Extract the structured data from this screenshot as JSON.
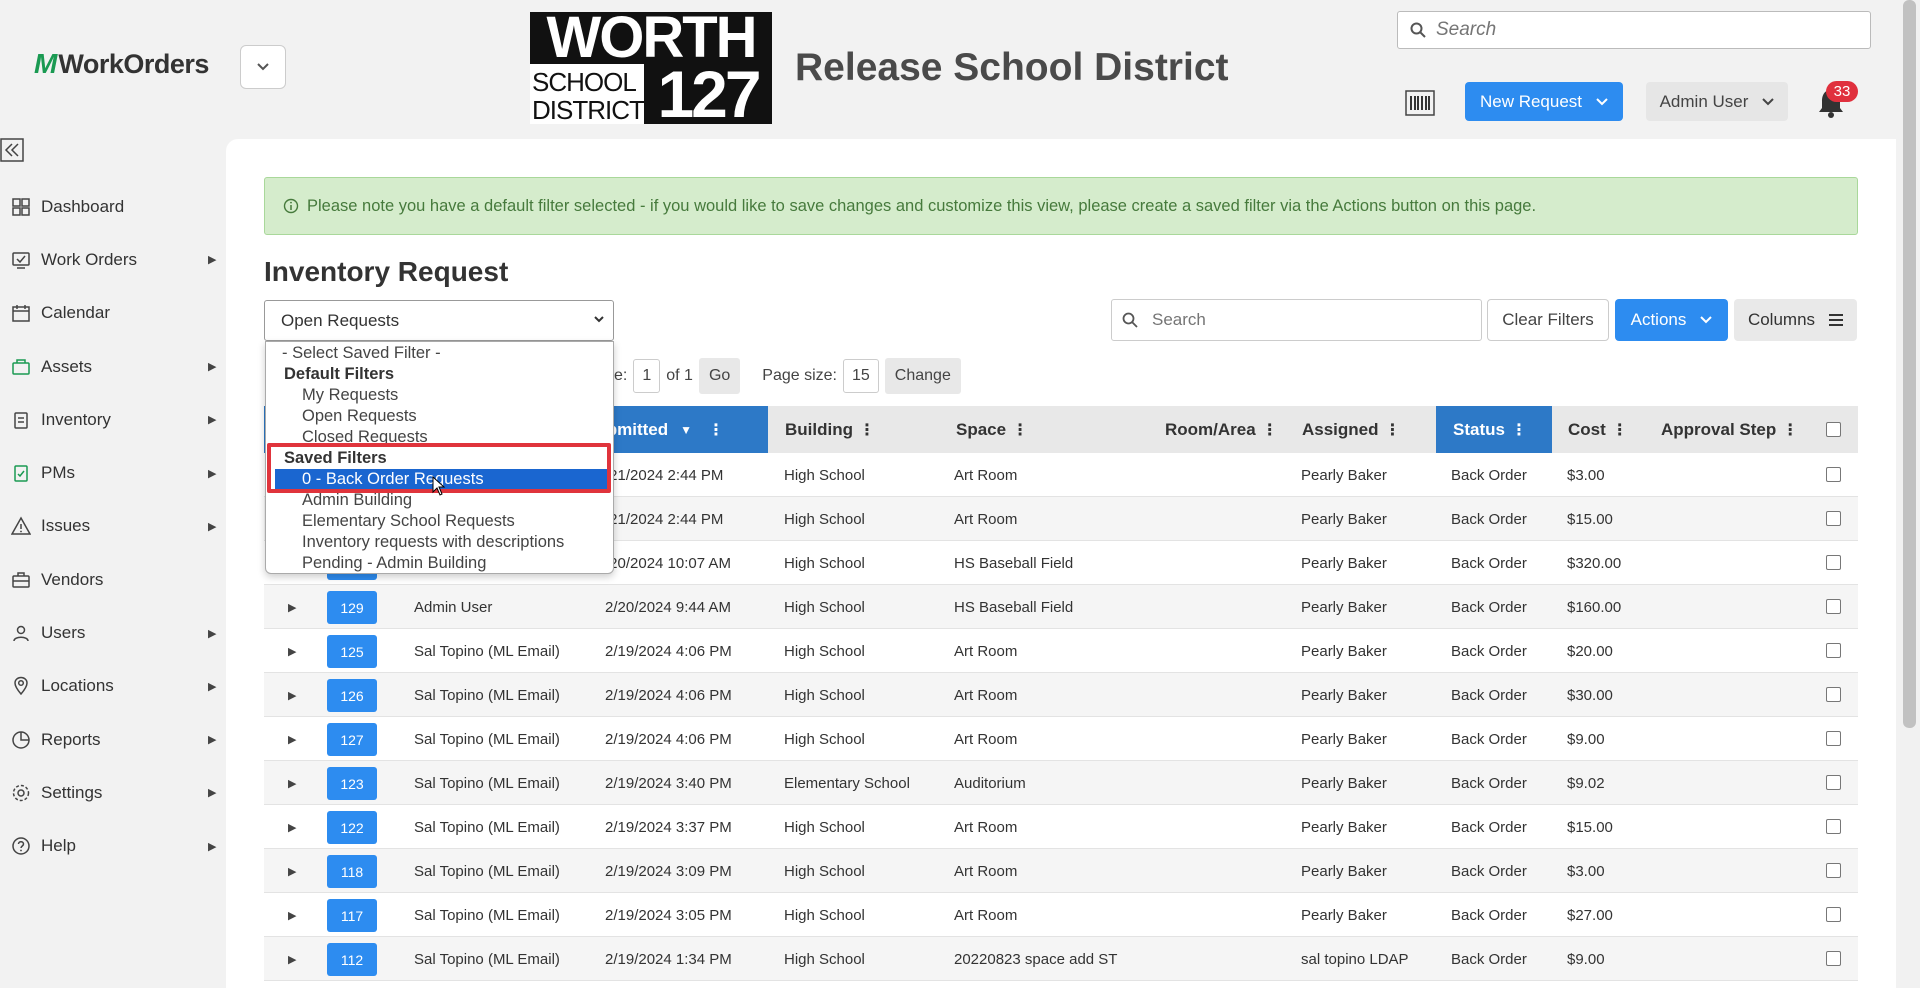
{
  "app": {
    "logo_text": "WorkOrders",
    "district_name": "Release School District",
    "district_logo": {
      "line1": "WORTH",
      "line2a": "SCHOOL",
      "line2b": "DISTRICT",
      "number": "127"
    }
  },
  "header": {
    "search_placeholder": "Search",
    "new_request_label": "New Request",
    "user_label": "Admin User",
    "notifications_count": "33"
  },
  "sidebar": {
    "items": [
      {
        "label": "Dashboard",
        "icon": "dashboard-icon",
        "has_sub": false
      },
      {
        "label": "Work Orders",
        "icon": "work-orders-icon",
        "has_sub": true
      },
      {
        "label": "Calendar",
        "icon": "calendar-icon",
        "has_sub": false
      },
      {
        "label": "Assets",
        "icon": "assets-icon",
        "has_sub": true
      },
      {
        "label": "Inventory",
        "icon": "inventory-icon",
        "has_sub": true
      },
      {
        "label": "PMs",
        "icon": "pms-icon",
        "has_sub": true
      },
      {
        "label": "Issues",
        "icon": "issues-icon",
        "has_sub": true
      },
      {
        "label": "Vendors",
        "icon": "vendors-icon",
        "has_sub": false
      },
      {
        "label": "Users",
        "icon": "users-icon",
        "has_sub": true
      },
      {
        "label": "Locations",
        "icon": "locations-icon",
        "has_sub": true
      },
      {
        "label": "Reports",
        "icon": "reports-icon",
        "has_sub": true
      },
      {
        "label": "Settings",
        "icon": "settings-icon",
        "has_sub": true
      },
      {
        "label": "Help",
        "icon": "help-icon",
        "has_sub": true
      }
    ]
  },
  "alert": {
    "text": "Please note you have a default filter selected - if you would like to save changes and customize this view, please create a saved filter via the Actions button on this page."
  },
  "page": {
    "title": "Inventory Request",
    "filter_value": "Open Requests"
  },
  "toolbar": {
    "search_placeholder": "Search",
    "clear_filters": "Clear Filters",
    "actions": "Actions",
    "columns": "Columns"
  },
  "pager": {
    "page_label": "e:",
    "page_value": "1",
    "of_label": "of 1",
    "go": "Go",
    "size_label": "Page size:",
    "size_value": "15",
    "change": "Change"
  },
  "dropdown": {
    "placeholder": "- Select Saved Filter -",
    "default_group": "Default Filters",
    "default_options": [
      "My Requests",
      "Open Requests",
      "Closed Requests"
    ],
    "saved_group": "Saved Filters",
    "saved_options": [
      "0 - Back Order Requests",
      "Admin Building",
      "Elementary School Requests",
      "Inventory requests with descriptions",
      "Pending - Admin Building"
    ],
    "selected": "0 - Back Order Requests"
  },
  "table": {
    "columns": {
      "submitted": "Submitted",
      "building": "Building",
      "space": "Space",
      "room": "Room/Area",
      "assigned": "Assigned",
      "status": "Status",
      "cost": "Cost",
      "approval": "Approval Step"
    },
    "rows": [
      {
        "id": "",
        "requester": "",
        "submitted": "/21/2024 2:44 PM",
        "building": "High School",
        "space": "Art Room",
        "assigned": "Pearly Baker",
        "status": "Back Order",
        "cost": "$3.00"
      },
      {
        "id": "",
        "requester": "",
        "submitted": "/21/2024 2:44 PM",
        "building": "High School",
        "space": "Art Room",
        "assigned": "Pearly Baker",
        "status": "Back Order",
        "cost": "$15.00"
      },
      {
        "id": "",
        "requester": "",
        "submitted": "/20/2024 10:07 AM",
        "building": "High School",
        "space": "HS Baseball Field",
        "assigned": "Pearly Baker",
        "status": "Back Order",
        "cost": "$320.00"
      },
      {
        "id": "129",
        "requester": "Admin User",
        "submitted": "2/20/2024 9:44 AM",
        "building": "High School",
        "space": "HS Baseball Field",
        "assigned": "Pearly Baker",
        "status": "Back Order",
        "cost": "$160.00"
      },
      {
        "id": "125",
        "requester": "Sal Topino (ML Email)",
        "submitted": "2/19/2024 4:06 PM",
        "building": "High School",
        "space": "Art Room",
        "assigned": "Pearly Baker",
        "status": "Back Order",
        "cost": "$20.00"
      },
      {
        "id": "126",
        "requester": "Sal Topino (ML Email)",
        "submitted": "2/19/2024 4:06 PM",
        "building": "High School",
        "space": "Art Room",
        "assigned": "Pearly Baker",
        "status": "Back Order",
        "cost": "$30.00"
      },
      {
        "id": "127",
        "requester": "Sal Topino (ML Email)",
        "submitted": "2/19/2024 4:06 PM",
        "building": "High School",
        "space": "Art Room",
        "assigned": "Pearly Baker",
        "status": "Back Order",
        "cost": "$9.00"
      },
      {
        "id": "123",
        "requester": "Sal Topino (ML Email)",
        "submitted": "2/19/2024 3:40 PM",
        "building": "Elementary School",
        "space": "Auditorium",
        "assigned": "Pearly Baker",
        "status": "Back Order",
        "cost": "$9.02"
      },
      {
        "id": "122",
        "requester": "Sal Topino (ML Email)",
        "submitted": "2/19/2024 3:37 PM",
        "building": "High School",
        "space": "Art Room",
        "assigned": "Pearly Baker",
        "status": "Back Order",
        "cost": "$15.00"
      },
      {
        "id": "118",
        "requester": "Sal Topino (ML Email)",
        "submitted": "2/19/2024 3:09 PM",
        "building": "High School",
        "space": "Art Room",
        "assigned": "Pearly Baker",
        "status": "Back Order",
        "cost": "$3.00"
      },
      {
        "id": "117",
        "requester": "Sal Topino (ML Email)",
        "submitted": "2/19/2024 3:05 PM",
        "building": "High School",
        "space": "Art Room",
        "assigned": "Pearly Baker",
        "status": "Back Order",
        "cost": "$27.00"
      },
      {
        "id": "112",
        "requester": "Sal Topino (ML Email)",
        "submitted": "2/19/2024 1:34 PM",
        "building": "High School",
        "space": "20220823 space add ST",
        "assigned": "sal topino LDAP",
        "status": "Back Order",
        "cost": "$9.00"
      }
    ]
  },
  "colors": {
    "accent": "#2d8cf0",
    "header_blue": "#2d79c7",
    "alert_bg": "#d5eccc",
    "alert_text": "#467a3c",
    "badge_red": "#e0303d",
    "highlight_red": "#e0343c",
    "brand_green": "#1a9a52"
  }
}
